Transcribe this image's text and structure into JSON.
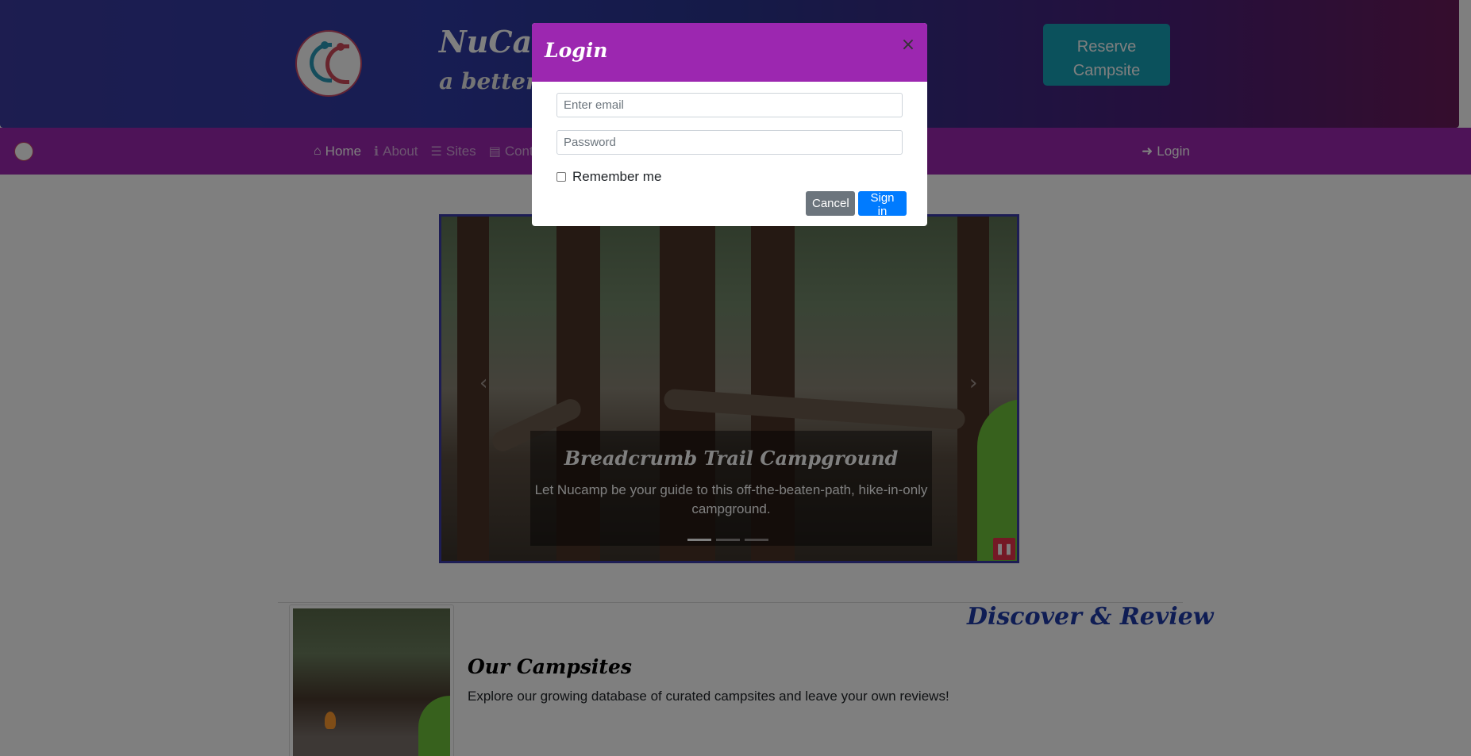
{
  "header": {
    "brand_title": "NuCamp",
    "brand_subtitle": "a better way to camp",
    "reserve_button": "Reserve Campsite"
  },
  "navbar": {
    "links": [
      {
        "icon": "home-icon",
        "label": "Home",
        "active": true
      },
      {
        "icon": "info-icon",
        "label": "About",
        "active": false
      },
      {
        "icon": "list-icon",
        "label": "Sites",
        "active": false
      },
      {
        "icon": "address-card-icon",
        "label": "Contact",
        "active": false
      }
    ],
    "login": "Login"
  },
  "carousel": {
    "caption_title": "Breadcrumb Trail Campground",
    "caption_text": "Let Nucamp be your guide to this off-the-beaten-path, hike-in-only campground.",
    "slide_count": 3,
    "active_slide": 1
  },
  "section": {
    "heading": "Discover & Review",
    "media_title": "Our Campsites",
    "media_text": "Explore our growing database of curated campsites and leave your own reviews!"
  },
  "modal": {
    "title": "Login",
    "close": "×",
    "email_placeholder": "Enter email",
    "password_placeholder": "Password",
    "remember_label": "Remember me",
    "cancel_button": "Cancel",
    "signin_button": "Sign in"
  },
  "colors": {
    "navbar": "#9c27b0",
    "reserve_button": "#17a2b8",
    "signin_button": "#007bff",
    "cancel_button": "#6c757d",
    "pause_button": "#e8334a",
    "heading_blue": "#1e3aa8"
  }
}
